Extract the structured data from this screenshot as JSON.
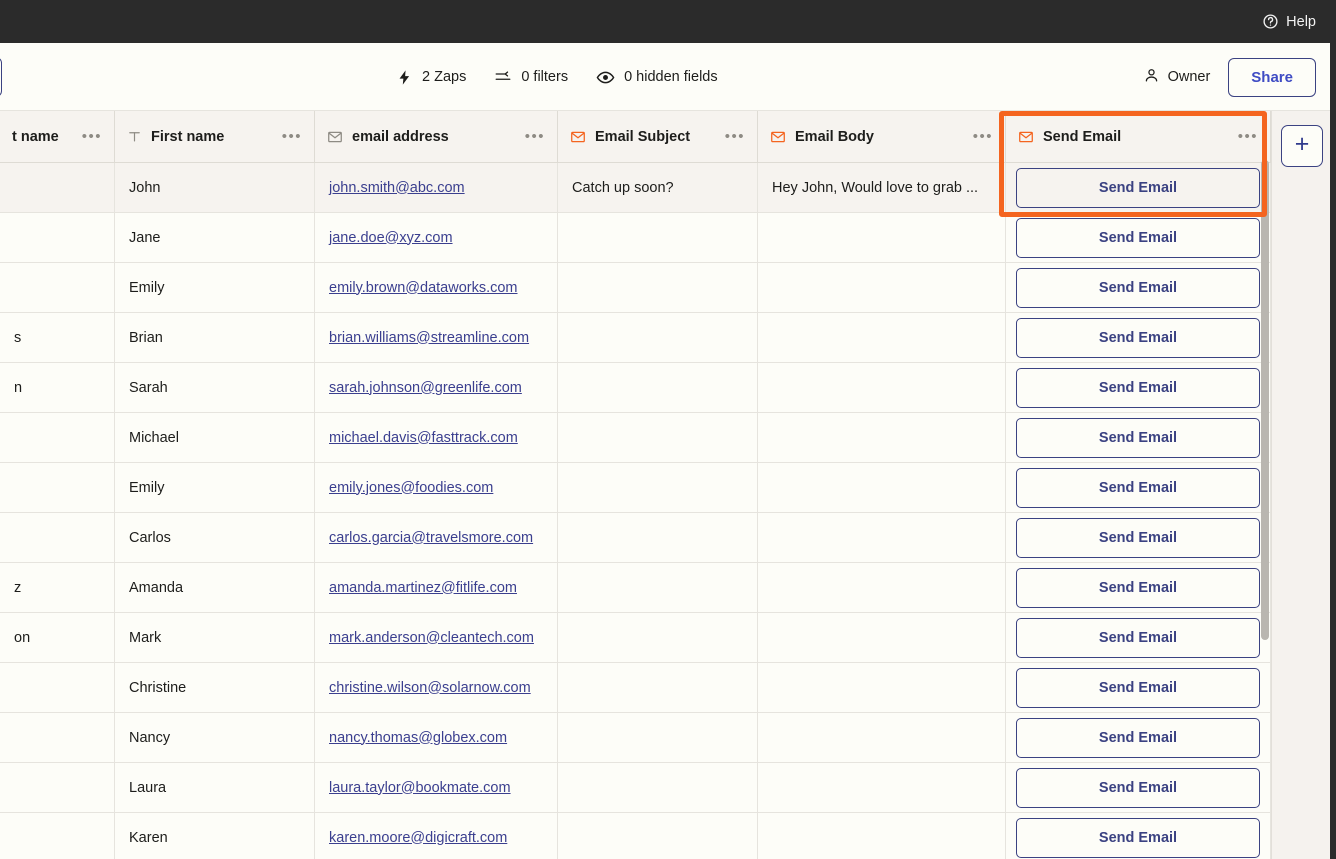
{
  "topbar": {
    "help_label": "Help",
    "help_icon": "question-circle-icon",
    "background": "#2b2b2b"
  },
  "toolbar": {
    "items": [
      {
        "icon": "lightning-bolt-icon",
        "label": "2 Zaps"
      },
      {
        "icon": "filter-icon",
        "label": "0 filters"
      },
      {
        "icon": "eye-icon",
        "label": "0 hidden fields"
      }
    ],
    "owner_label": "Owner",
    "owner_icon": "person-icon",
    "share_label": "Share",
    "share_color": "#3f4cc4"
  },
  "grid": {
    "add_field_label": "+",
    "columns": [
      {
        "key": "last_name",
        "label": "t name",
        "icon": "none",
        "icon_color": ""
      },
      {
        "key": "first_name",
        "label": "First name",
        "icon": "text-icon",
        "icon_color": "#8e8b84"
      },
      {
        "key": "email",
        "label": "email address",
        "icon": "envelope-icon",
        "icon_color": "#8e8b84"
      },
      {
        "key": "subject",
        "label": "Email Subject",
        "icon": "envelope-icon",
        "icon_color": "#f4641f"
      },
      {
        "key": "body",
        "label": "Email Body",
        "icon": "envelope-icon",
        "icon_color": "#f4641f"
      },
      {
        "key": "send",
        "label": "Send Email",
        "icon": "envelope-icon",
        "icon_color": "#f4641f"
      }
    ],
    "menu_glyph": "•••",
    "send_button_label": "Send Email",
    "rows": [
      {
        "last_name": "",
        "first_name": "John",
        "email": "john.smith@abc.com",
        "subject": "Catch up soon?",
        "body": "Hey John, Would love to grab ..."
      },
      {
        "last_name": "",
        "first_name": "Jane",
        "email": "jane.doe@xyz.com",
        "subject": "",
        "body": ""
      },
      {
        "last_name": "",
        "first_name": "Emily",
        "email": "emily.brown@dataworks.com",
        "subject": "",
        "body": ""
      },
      {
        "last_name": "s",
        "first_name": "Brian",
        "email": "brian.williams@streamline.com",
        "subject": "",
        "body": ""
      },
      {
        "last_name": "n",
        "first_name": "Sarah",
        "email": "sarah.johnson@greenlife.com",
        "subject": "",
        "body": ""
      },
      {
        "last_name": "",
        "first_name": "Michael",
        "email": "michael.davis@fasttrack.com",
        "subject": "",
        "body": ""
      },
      {
        "last_name": "",
        "first_name": "Emily",
        "email": "emily.jones@foodies.com",
        "subject": "",
        "body": ""
      },
      {
        "last_name": "",
        "first_name": "Carlos",
        "email": "carlos.garcia@travelsmore.com",
        "subject": "",
        "body": ""
      },
      {
        "last_name": "z",
        "first_name": "Amanda",
        "email": "amanda.martinez@fitlife.com",
        "subject": "",
        "body": ""
      },
      {
        "last_name": "on",
        "first_name": "Mark",
        "email": "mark.anderson@cleantech.com",
        "subject": "",
        "body": ""
      },
      {
        "last_name": "",
        "first_name": "Christine",
        "email": "christine.wilson@solarnow.com",
        "subject": "",
        "body": ""
      },
      {
        "last_name": "",
        "first_name": "Nancy",
        "email": "nancy.thomas@globex.com",
        "subject": "",
        "body": ""
      },
      {
        "last_name": "",
        "first_name": "Laura",
        "email": "laura.taylor@bookmate.com",
        "subject": "",
        "body": ""
      },
      {
        "last_name": "",
        "first_name": "Karen",
        "email": "karen.moore@digicraft.com",
        "subject": "",
        "body": ""
      }
    ]
  },
  "annotation": {
    "highlight_color": "#f4641f",
    "target": "Send Email column header and first row button"
  }
}
